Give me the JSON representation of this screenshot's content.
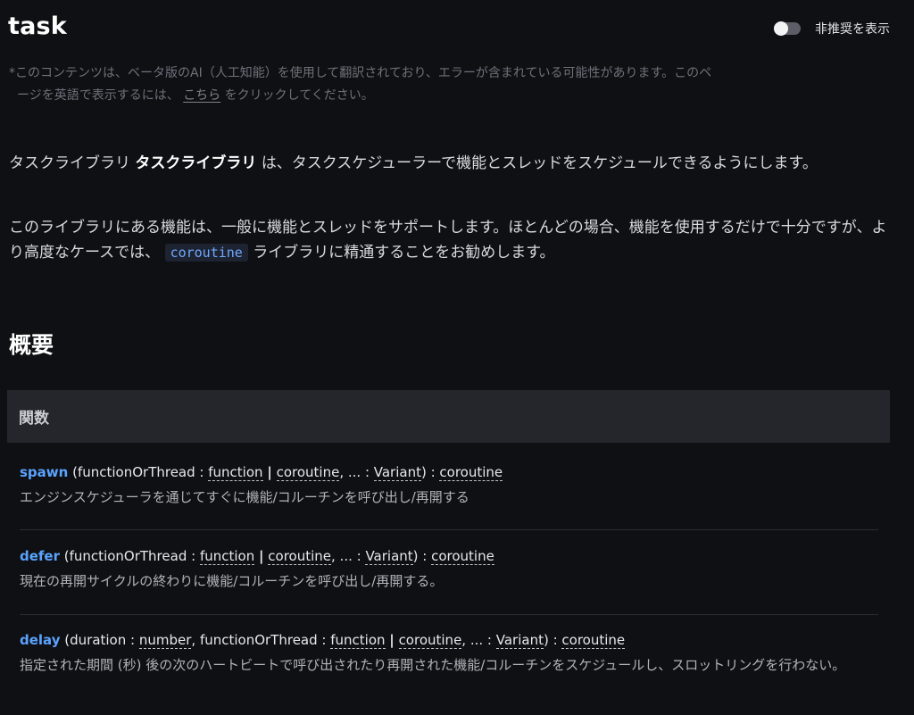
{
  "page": {
    "title": "task",
    "deprecated_toggle_label": "非推奨を表示"
  },
  "translation_note": {
    "line1": "*このコンテンツは、ベータ版のAI（人工知能）を使用して翻訳されており、エラーが含まれている可能性があります。このペ",
    "line2_prefix": "ージを英語で表示するには、",
    "link": "こちら",
    "line2_suffix": "をクリックしてください。"
  },
  "intro": {
    "p1_prefix": "タスクライブラリ",
    "p1_bold": "タスクライブラリ",
    "p1_suffix": "は、タスクスケジューラーで機能とスレッドをスケジュールできるようにします。",
    "p2_prefix": "このライブラリにある機能は、一般に機能とスレッドをサポートします。ほとんどの場合、機能を使用するだけで十分ですが、より高度なケースでは、",
    "p2_code": "coroutine",
    "p2_suffix": "ライブラリに精通することをお勧めします。"
  },
  "summary": {
    "heading": "概要",
    "table_header": "関数"
  },
  "functions": [
    {
      "name": "spawn",
      "param1": "functionOrThread",
      "type1": "function",
      "type2": "coroutine",
      "rest": "...",
      "rest_type": "Variant",
      "return_type": "coroutine",
      "description": "エンジンスケジューラを通じてすぐに機能/コルーチンを呼び出し/再開する"
    },
    {
      "name": "defer",
      "param1": "functionOrThread",
      "type1": "function",
      "type2": "coroutine",
      "rest": "...",
      "rest_type": "Variant",
      "return_type": "coroutine",
      "description": "現在の再開サイクルの終わりに機能/コルーチンを呼び出し/再開する。"
    },
    {
      "name": "delay",
      "param0": "duration",
      "type0": "number",
      "param1": "functionOrThread",
      "type1": "function",
      "type2": "coroutine",
      "rest": "...",
      "rest_type": "Variant",
      "return_type": "coroutine",
      "description": "指定された期間 (秒) 後の次のハートビートで呼び出されたり再開された機能/コルーチンをスケジュールし、スロットリングを行わない。"
    }
  ]
}
